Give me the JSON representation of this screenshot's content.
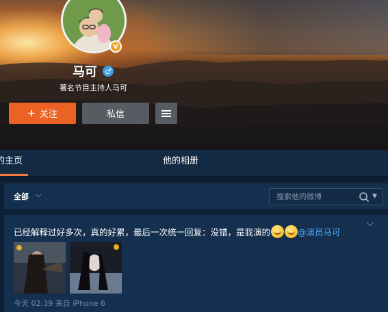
{
  "profile": {
    "name": "马可",
    "description": "著名节目主持人马可",
    "vip_badge": "V",
    "gender_icon": "male-icon"
  },
  "actions": {
    "follow_label": "关注",
    "follow_plus": "+",
    "message_label": "私信",
    "more_icon": "menu-icon"
  },
  "tabs": [
    {
      "label": "的主页",
      "active": true
    },
    {
      "label": "他的相册",
      "active": false
    }
  ],
  "filter": {
    "selected": "全部",
    "search_placeholder": "搜索他的微博"
  },
  "post": {
    "text": "已经解释过好多次，真的好累，最后一次统一回复：没错，是我演的",
    "mention": "@演员马可",
    "meta": "今天 02:39 来自 iPhone 6",
    "image_count": 2
  },
  "colors": {
    "accent": "#ec6225",
    "background": "#0e2036",
    "card": "#14304e",
    "link": "#4ba2f2",
    "tab_underline": "#fa7d3c"
  }
}
